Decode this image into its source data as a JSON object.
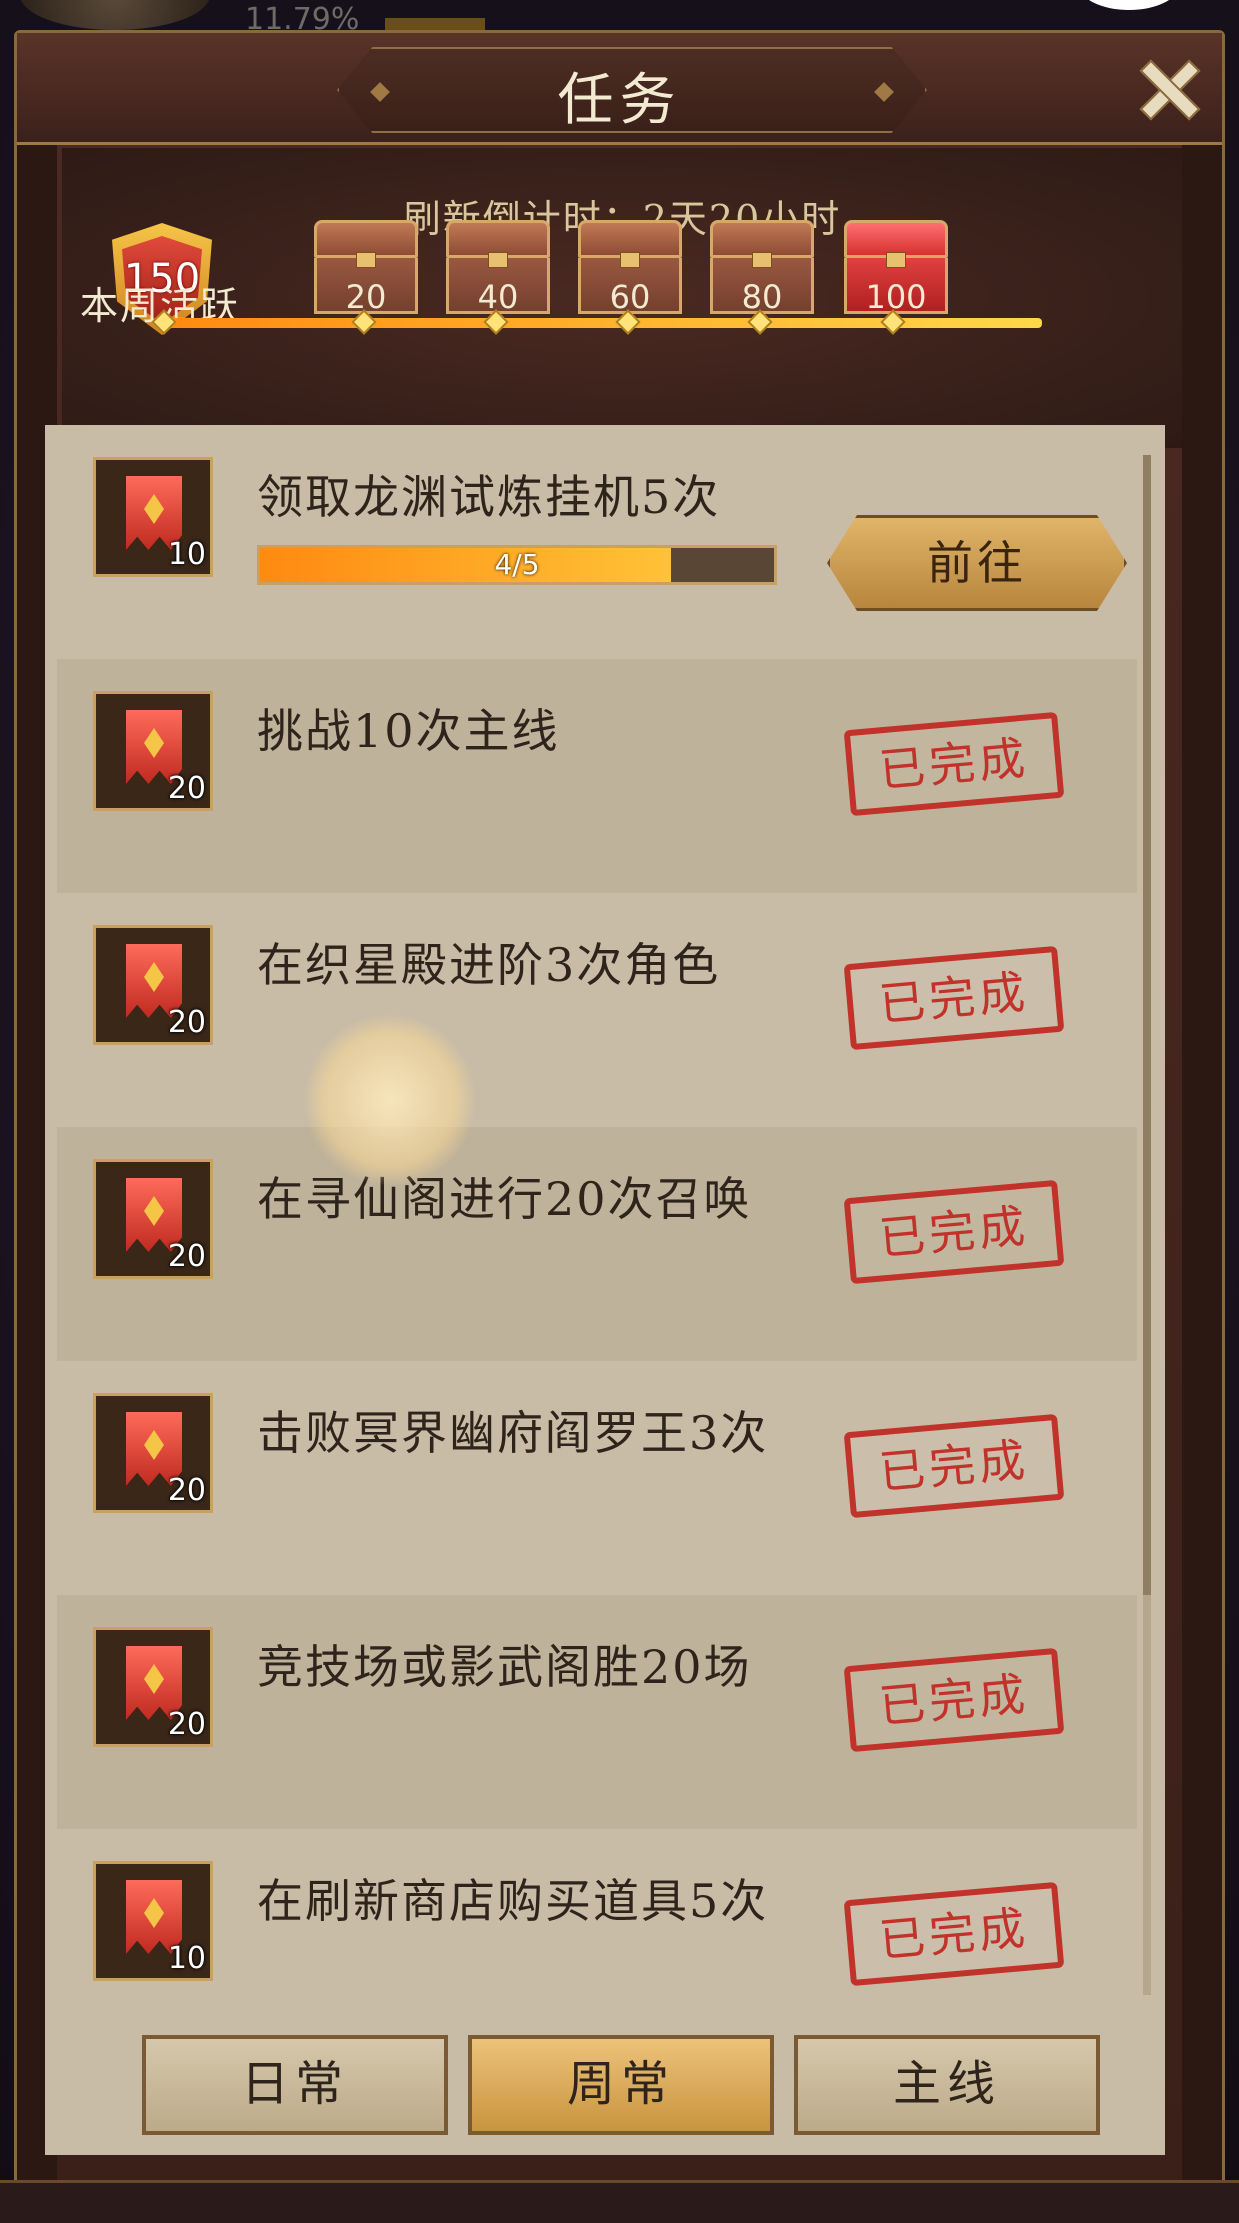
{
  "topbar": {
    "percent": "11.79%"
  },
  "window": {
    "title": "任务"
  },
  "activity": {
    "refresh_label": "刷新倒计时：",
    "refresh_value": "2天20小时",
    "weekly_points": "150",
    "weekly_label": "本周活跃",
    "chests": [
      {
        "label": "20",
        "opened": false
      },
      {
        "label": "40",
        "opened": false
      },
      {
        "label": "60",
        "opened": false
      },
      {
        "label": "80",
        "opened": false
      },
      {
        "label": "100",
        "opened": false,
        "highlight": true
      }
    ],
    "progress_fraction": 1.0
  },
  "tasks": [
    {
      "title": "领取龙渊试炼挂机5次",
      "points": "10",
      "progress_text": "4/5",
      "progress_fraction": 0.8,
      "action": "前往",
      "done": false
    },
    {
      "title": "挑战10次主线",
      "points": "20",
      "stamp": "已完成",
      "done": true
    },
    {
      "title": "在织星殿进阶3次角色",
      "points": "20",
      "stamp": "已完成",
      "done": true
    },
    {
      "title": "在寻仙阁进行20次召唤",
      "points": "20",
      "stamp": "已完成",
      "done": true
    },
    {
      "title": "击败冥界幽府阎罗王3次",
      "points": "20",
      "stamp": "已完成",
      "done": true
    },
    {
      "title": "竞技场或影武阁胜20场",
      "points": "20",
      "stamp": "已完成",
      "done": true
    },
    {
      "title": "在刷新商店购买道具5次",
      "points": "10",
      "stamp": "已完成",
      "done": true
    }
  ],
  "tabs": [
    {
      "label": "日常",
      "active": false
    },
    {
      "label": "周常",
      "active": true
    },
    {
      "label": "主线",
      "active": false
    }
  ],
  "colors": {
    "accent_gold": "#c9a062",
    "stamp_red": "#c0322a",
    "progress_orange": "#ff8a10"
  }
}
